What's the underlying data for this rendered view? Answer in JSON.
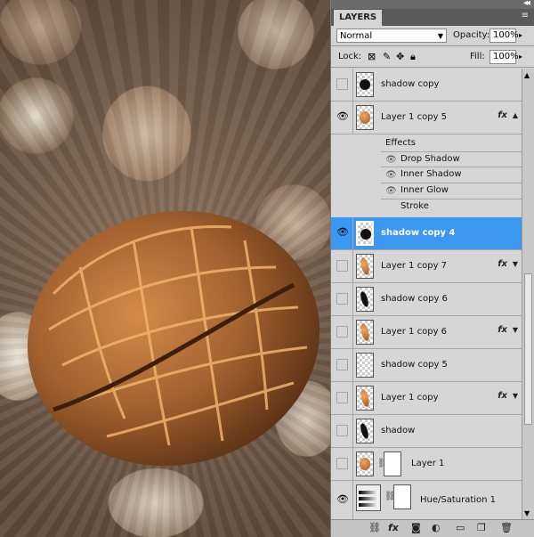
{
  "panel": {
    "tab_label": "LAYERS",
    "blend_mode": "Normal",
    "opacity_label": "Opacity:",
    "opacity_value": "100%",
    "lock_label": "Lock:",
    "fill_label": "Fill:",
    "fill_value": "100%"
  },
  "layers": [
    {
      "name": "shadow copy",
      "visible": false,
      "thumb": "round-shadow",
      "fx": false
    },
    {
      "name": "Layer 1 copy 5",
      "visible": true,
      "thumb": "nut",
      "fx": true,
      "expanded": true
    },
    {
      "name": "shadow copy 4",
      "visible": true,
      "thumb": "round-shadow",
      "fx": false,
      "selected": true
    },
    {
      "name": "Layer 1 copy 7",
      "visible": false,
      "thumb": "nut-slim",
      "fx": true
    },
    {
      "name": "shadow copy 6",
      "visible": false,
      "thumb": "slim-shadow",
      "fx": false
    },
    {
      "name": "Layer 1 copy 6",
      "visible": false,
      "thumb": "nut-slim",
      "fx": true
    },
    {
      "name": "shadow copy 5",
      "visible": false,
      "thumb": "empty",
      "fx": false
    },
    {
      "name": "Layer 1 copy",
      "visible": false,
      "thumb": "nut-slim",
      "fx": true
    },
    {
      "name": "shadow",
      "visible": false,
      "thumb": "slim-shadow",
      "fx": false
    },
    {
      "name": "Layer 1",
      "visible": false,
      "thumb": "nut",
      "fx": false,
      "mask": true
    },
    {
      "name": "Hue/Saturation 1",
      "visible": true,
      "thumb": "adjustment",
      "fx": false,
      "mask": true
    }
  ],
  "effects": {
    "header": "Effects",
    "items": [
      "Drop Shadow",
      "Inner Shadow",
      "Inner Glow",
      "Stroke"
    ]
  },
  "icons": {
    "fx": "fx",
    "visibility": "eye-icon",
    "link": "chain-icon"
  }
}
